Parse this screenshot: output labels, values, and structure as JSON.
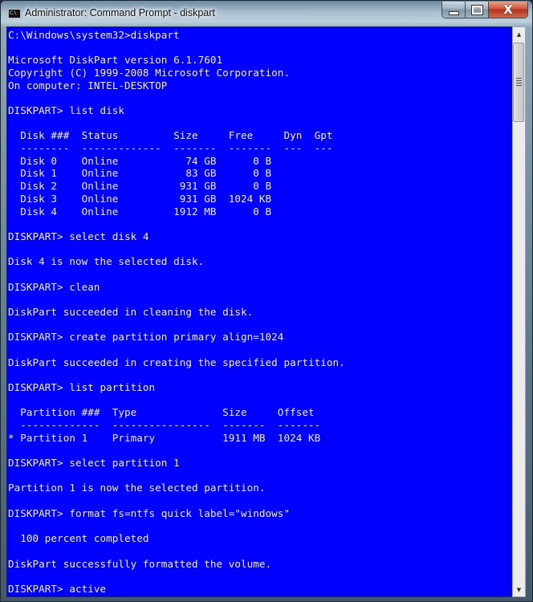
{
  "window": {
    "title": "Administrator: Command Prompt - diskpart",
    "icon": "cmd-icon",
    "icon_text": "C:\\",
    "buttons": {
      "minimize": "minimize-icon",
      "maximize": "maximize-icon",
      "close": "close-icon",
      "close_glyph": "X"
    }
  },
  "colors": {
    "console_background": "#0000ff",
    "console_text": "#f2f2f2",
    "close_button": "#c8452c"
  },
  "console": {
    "lines": [
      "C:\\Windows\\system32>diskpart",
      "",
      "Microsoft DiskPart version 6.1.7601",
      "Copyright (C) 1999-2008 Microsoft Corporation.",
      "On computer: INTEL-DESKTOP",
      "",
      "DISKPART> list disk",
      "",
      "  Disk ###  Status         Size     Free     Dyn  Gpt",
      "  --------  -------------  -------  -------  ---  ---",
      "  Disk 0    Online           74 GB      0 B",
      "  Disk 1    Online           83 GB      0 B",
      "  Disk 2    Online          931 GB      0 B",
      "  Disk 3    Online          931 GB  1024 KB",
      "  Disk 4    Online         1912 MB      0 B",
      "",
      "DISKPART> select disk 4",
      "",
      "Disk 4 is now the selected disk.",
      "",
      "DISKPART> clean",
      "",
      "DiskPart succeeded in cleaning the disk.",
      "",
      "DISKPART> create partition primary align=1024",
      "",
      "DiskPart succeeded in creating the specified partition.",
      "",
      "DISKPART> list partition",
      "",
      "  Partition ###  Type              Size     Offset",
      "  -------------  ----------------  -------  -------",
      "* Partition 1    Primary           1911 MB  1024 KB",
      "",
      "DISKPART> select partition 1",
      "",
      "Partition 1 is now the selected partition.",
      "",
      "DISKPART> format fs=ntfs quick label=\"windows\"",
      "",
      "  100 percent completed",
      "",
      "DiskPart successfully formatted the volume.",
      "",
      "DISKPART> active"
    ]
  },
  "scrollbar": {
    "up_arrow": "▲",
    "down_arrow": "▼",
    "position_fraction": 0.0
  }
}
